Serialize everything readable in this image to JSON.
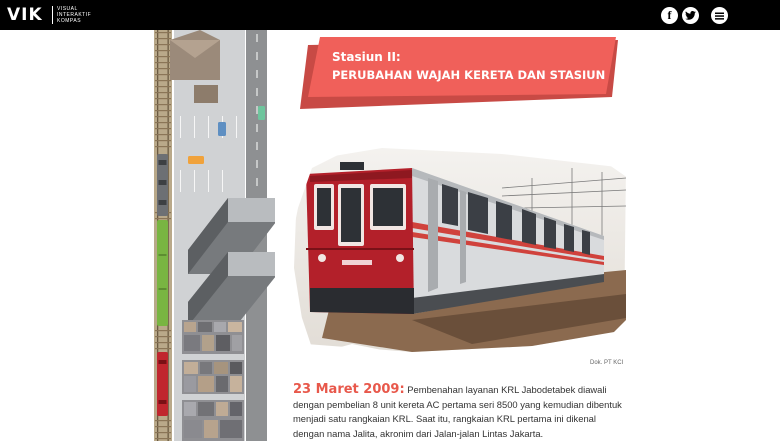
{
  "header": {
    "logo": "VIK",
    "logo_sub_lines": [
      "VISUAL",
      "INTERAKTIF",
      "KOMPAS"
    ],
    "icons": [
      "facebook-icon",
      "twitter-icon",
      "menu-icon"
    ],
    "background": "#000000"
  },
  "section": {
    "title": "Stasiun II:",
    "subtitle": "PERUBAHAN WAJAH KERETA DAN STASIUN",
    "banner_color": "#f0605a",
    "banner_shadow": "#c84a45"
  },
  "photo": {
    "credit": "Dok. PT KCI"
  },
  "article": {
    "date": "23 Maret 2009:",
    "text": " Pembenahan layanan KRL Jabodetabek diawali dengan pembelian 8 unit kereta AC pertama seri 8500 yang kemudian dibentuk menjadi satu rangkaian KRL. Saat itu, rangkaian KRL pertama ini dikenal dengan nama Jalita, akronim dari Jalan-jalan Lintas Jakarta.",
    "accent": "#e8584b"
  }
}
